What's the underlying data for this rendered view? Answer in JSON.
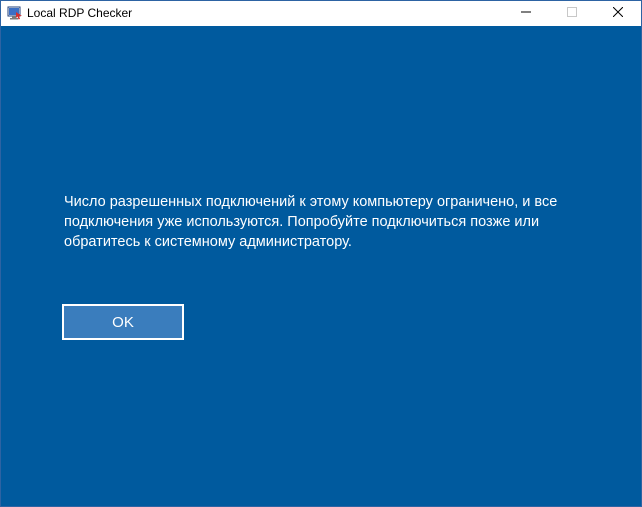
{
  "window": {
    "title": "Local RDP Checker",
    "icon": "rdp-app-icon",
    "controls": [
      "minimize-icon",
      "maximize-icon",
      "close-icon"
    ]
  },
  "dialog": {
    "message_lines": [
      "Число разрешенных подключений к этому компьютеру ограничено, и все",
      "подключения уже используются. Попробуйте подключиться позже или",
      "обратитесь к системному администратору."
    ],
    "ok_label": "OK"
  },
  "colors": {
    "background": "#005a9e",
    "button_fill": "#3a7dbd",
    "text": "#ffffff"
  }
}
